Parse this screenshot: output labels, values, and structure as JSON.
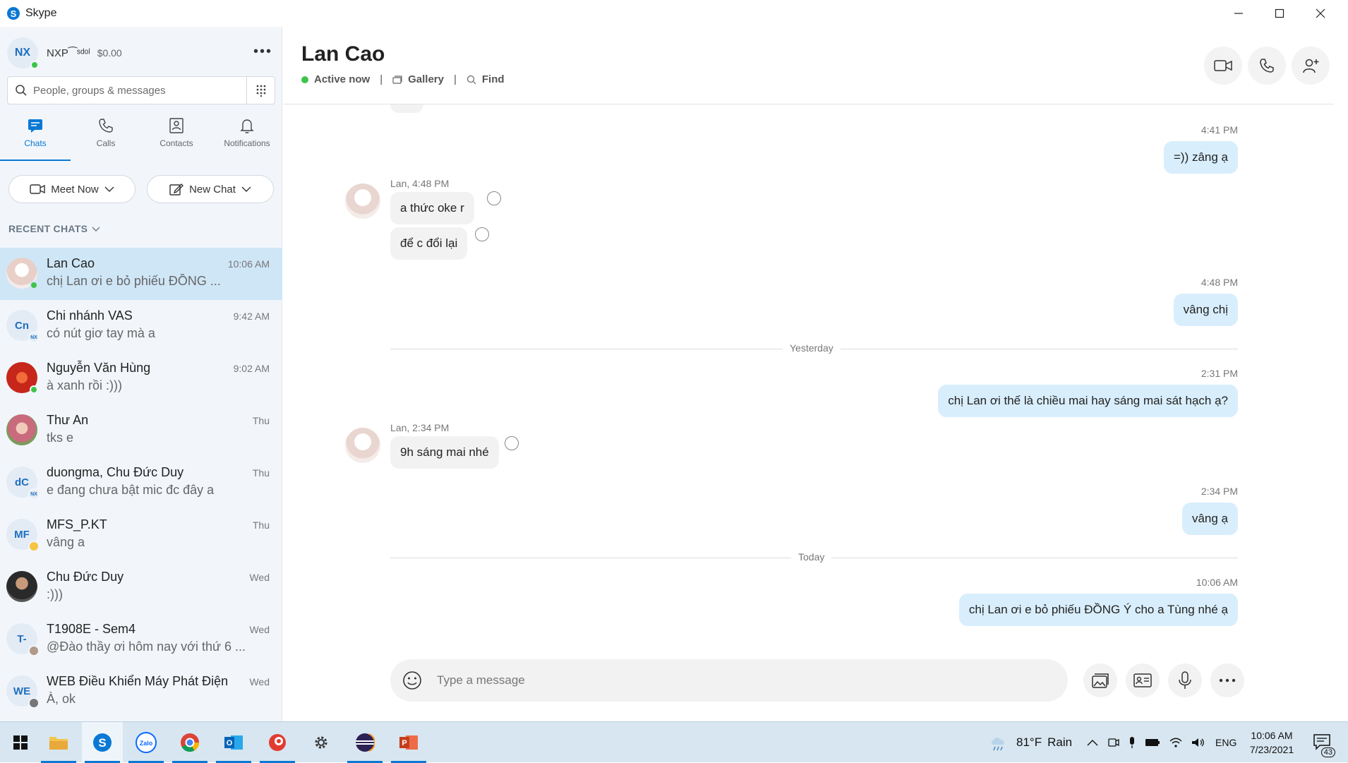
{
  "window": {
    "app_title": "Skype"
  },
  "profile": {
    "initials": "NX",
    "name": "NXP⁀ˢᵈᵒˡ",
    "credit": "$0.00"
  },
  "search": {
    "placeholder": "People, groups & messages"
  },
  "nav": {
    "chats": "Chats",
    "calls": "Calls",
    "contacts": "Contacts",
    "notifications": "Notifications"
  },
  "actions": {
    "meet_now": "Meet Now",
    "new_chat": "New Chat"
  },
  "recent_label": "RECENT CHATS",
  "chats": [
    {
      "name": "Lan Cao",
      "preview": "chị Lan ơi e bỏ phiếu ĐỒNG ...",
      "time": "10:06 AM",
      "initials": "",
      "color": "#f3e3df"
    },
    {
      "name": "Chi nhánh VAS",
      "preview": "có nút giơ tay mà a",
      "time": "9:42 AM",
      "initials": "Cn",
      "color": "#e3ebf5"
    },
    {
      "name": "Nguyễn Văn Hùng",
      "preview": "à xanh rồi :)))",
      "time": "9:02 AM",
      "initials": "",
      "color": "#c7261a"
    },
    {
      "name": "Thư An",
      "preview": "tks e",
      "time": "Thu",
      "initials": "",
      "color": "#c96b7d"
    },
    {
      "name": "duongma, Chu Đức Duy",
      "preview": "e đang chưa bật mic đc đây a",
      "time": "Thu",
      "initials": "dC",
      "color": "#e3ebf5"
    },
    {
      "name": "MFS_P.KT",
      "preview": "vâng a",
      "time": "Thu",
      "initials": "MF",
      "color": "#e3ebf5"
    },
    {
      "name": "Chu Đức Duy",
      "preview": ":)))",
      "time": "Wed",
      "initials": "",
      "color": "#3a3a3a"
    },
    {
      "name": "T1908E - Sem4",
      "preview": "@Đào thầy ơi hôm nay với thứ 6 ...",
      "time": "Wed",
      "initials": "T-",
      "color": "#e3ebf5"
    },
    {
      "name": "WEB Điều Khiển Máy Phát Điện",
      "preview": "À, ok",
      "time": "Wed",
      "initials": "WE",
      "color": "#e3ebf5"
    }
  ],
  "conversation": {
    "contact_name": "Lan Cao",
    "status": "Active now",
    "gallery": "Gallery",
    "find": "Find",
    "messages": {
      "m1_time": "4:41 PM",
      "m1_text": "=)) zâng ạ",
      "m2_sender": "Lan, 4:48 PM",
      "m2_text": "a thức oke r",
      "m3_text": "để c đổi lại",
      "m4_time": "4:48 PM",
      "m4_text": "vâng chị",
      "div_yesterday": "Yesterday",
      "m5_time": "2:31 PM",
      "m5_text": "chị Lan ơi thế là chiều mai hay sáng mai sát hạch ạ?",
      "m6_sender": "Lan, 2:34 PM",
      "m6_text": "9h sáng mai nhé",
      "m7_time": "2:34 PM",
      "m7_text": "vâng ạ",
      "div_today": "Today",
      "m8_time": "10:06 AM",
      "m8_text": "chị Lan ơi e bỏ phiếu ĐỒNG Ý cho a Tùng nhé ạ",
      "partial_top": "...."
    },
    "composer_placeholder": "Type a message"
  },
  "taskbar": {
    "weather_temp": "81°F",
    "weather_desc": "Rain",
    "lang": "ENG",
    "clock_time": "10:06 AM",
    "clock_date": "7/23/2021",
    "notif_count": "43"
  },
  "colors": {
    "accent": "#0a78d4",
    "online": "#3ec34a",
    "outgoing_bubble": "#d9eefc",
    "incoming_bubble": "#f2f2f2",
    "active_chat": "#cfe6f7"
  }
}
